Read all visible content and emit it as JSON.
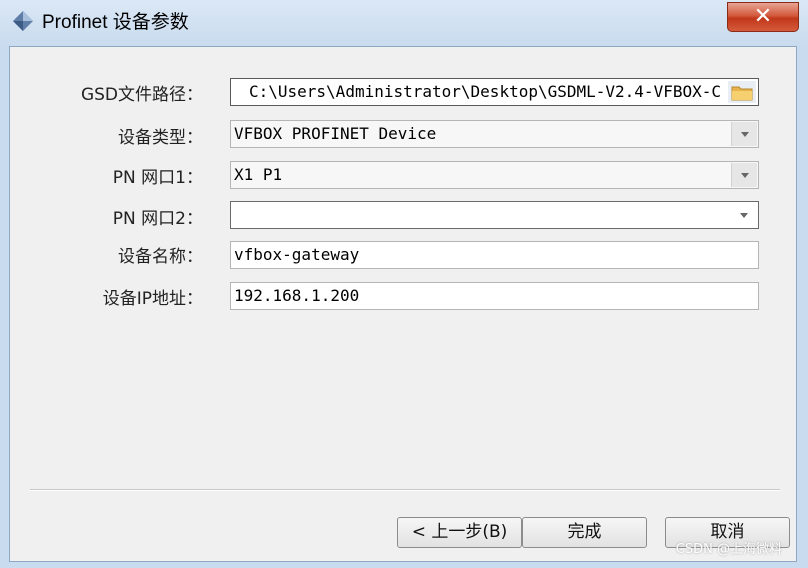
{
  "window": {
    "title": "Profinet 设备参数",
    "close_label": "✕"
  },
  "form": {
    "gsd_path": {
      "label": "GSD文件路径：",
      "value": "C:\\Users\\Administrator\\Desktop\\GSDML-V2.4-VFBOX-C"
    },
    "device_type": {
      "label": "设备类型：",
      "value": "VFBOX PROFINET Device"
    },
    "pn_port1": {
      "label": "PN 网口1：",
      "value": "X1 P1"
    },
    "pn_port2": {
      "label": "PN 网口2：",
      "value": ""
    },
    "device_name": {
      "label": "设备名称：",
      "value": "vfbox-gateway"
    },
    "device_ip": {
      "label": "设备IP地址：",
      "value": "192.168.1.200"
    }
  },
  "buttons": {
    "back": "< 上一步(B)",
    "finish": "完成",
    "cancel": "取消"
  },
  "watermark": "CSDN @上海微料",
  "icons": {
    "app": "app-diamond-icon",
    "folder": "folder-icon",
    "dropdown": "chevron-down-icon",
    "close": "close-icon"
  },
  "colors": {
    "titlebar": "#c9dbee",
    "close_button": "#c1381b",
    "folder": "#e9b44c"
  }
}
